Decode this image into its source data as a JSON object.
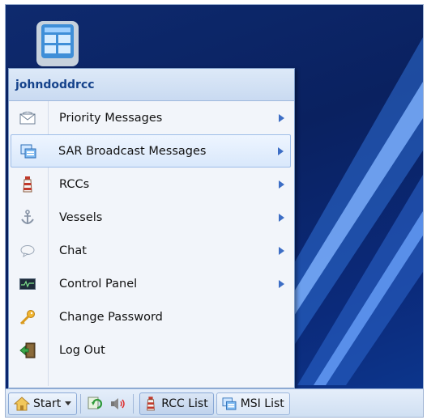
{
  "menu": {
    "username": "johndoddrcc",
    "items": [
      {
        "label": "Priority Messages",
        "icon": "envelope-icon",
        "submenu": true
      },
      {
        "label": "SAR Broadcast Messages",
        "icon": "broadcast-window-icon",
        "submenu": true,
        "active": true
      },
      {
        "label": "RCCs",
        "icon": "lighthouse-icon",
        "submenu": true
      },
      {
        "label": "Vessels",
        "icon": "anchor-icon",
        "submenu": true
      },
      {
        "label": "Chat",
        "icon": "chat-bubble-icon",
        "submenu": true
      },
      {
        "label": "Control Panel",
        "icon": "monitor-pulse-icon",
        "submenu": true
      },
      {
        "label": "Change Password",
        "icon": "key-icon",
        "submenu": false
      },
      {
        "label": "Log Out",
        "icon": "exit-door-icon",
        "submenu": false
      }
    ]
  },
  "taskbar": {
    "start_label": "Start",
    "rcc_list_label": "RCC List",
    "msi_list_label": "MSI List"
  },
  "colors": {
    "desktop_bg": "#0a2160",
    "menu_header_text": "#15428b",
    "arrow": "#3d6ec5"
  }
}
